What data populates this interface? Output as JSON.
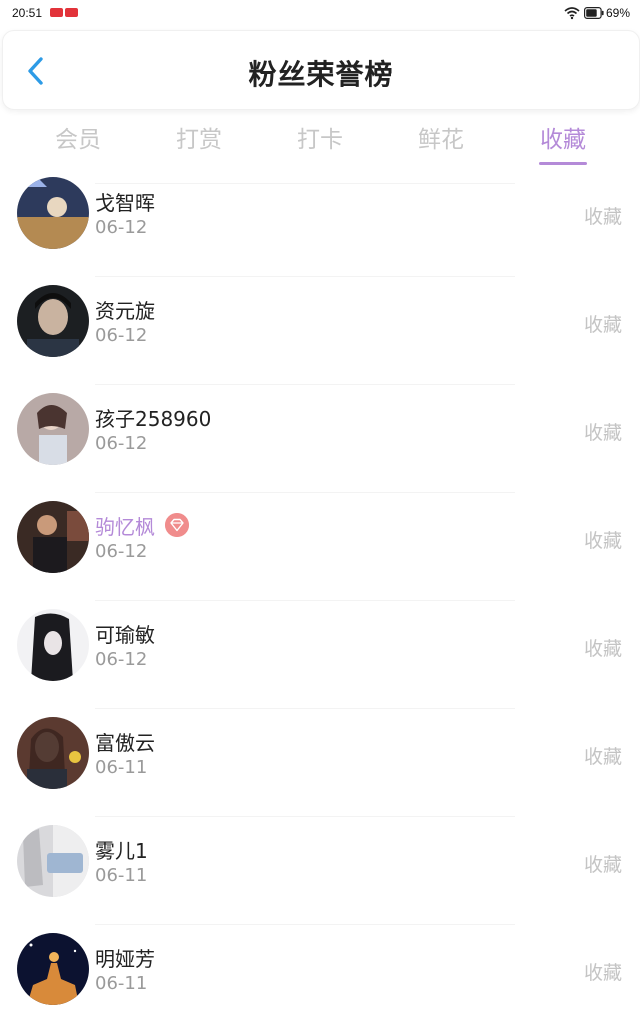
{
  "status_bar": {
    "time": "20:51",
    "battery": "69%"
  },
  "header": {
    "title": "粉丝荣誉榜"
  },
  "tabs": [
    {
      "label": "会员",
      "active": false
    },
    {
      "label": "打赏",
      "active": false
    },
    {
      "label": "打卡",
      "active": false
    },
    {
      "label": "鲜花",
      "active": false
    },
    {
      "label": "收藏",
      "active": true
    }
  ],
  "list": [
    {
      "name": "戈智晖",
      "date": "06-12",
      "action": "收藏",
      "vip": false
    },
    {
      "name": "资元旋",
      "date": "06-12",
      "action": "收藏",
      "vip": false
    },
    {
      "name": "孩子258960",
      "date": "06-12",
      "action": "收藏",
      "vip": false
    },
    {
      "name": "驹忆枫",
      "date": "06-12",
      "action": "收藏",
      "vip": true
    },
    {
      "name": "可瑜敏",
      "date": "06-12",
      "action": "收藏",
      "vip": false
    },
    {
      "name": "富傲云",
      "date": "06-11",
      "action": "收藏",
      "vip": false
    },
    {
      "name": "雾儿1",
      "date": "06-11",
      "action": "收藏",
      "vip": false
    },
    {
      "name": "明娅芳",
      "date": "06-11",
      "action": "收藏",
      "vip": false
    }
  ],
  "colors": {
    "accent": "#b48ad8",
    "back_arrow": "#2d9be6",
    "inactive_tab": "#c7c7c7",
    "action_text": "#c4c4c4",
    "date_text": "#9a9a9a",
    "vip_badge": "#f08c8c"
  },
  "icons": {
    "back": "chevron-left-icon",
    "wifi": "wifi-icon",
    "battery": "battery-icon",
    "vip": "diamond-icon"
  }
}
